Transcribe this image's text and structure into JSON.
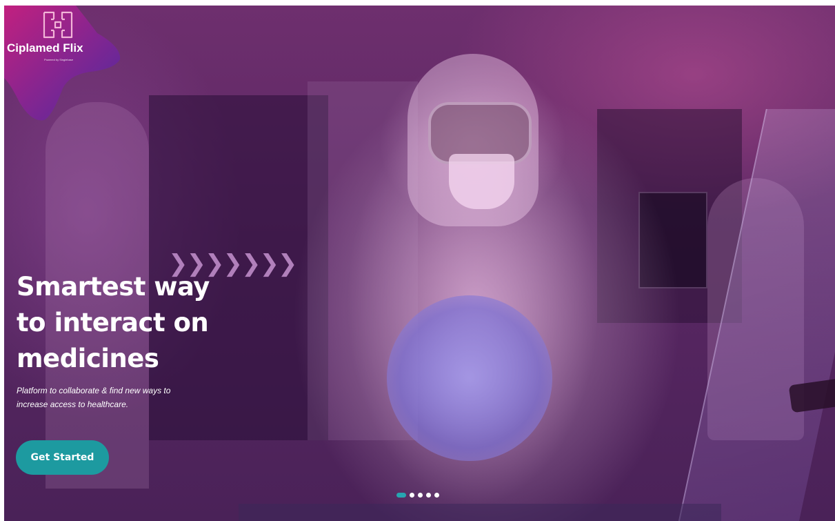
{
  "brand": {
    "name": "Ciplamed Flix",
    "tagline": "Powered by Singlebase",
    "logo_icon": "medical-cross-logo-icon",
    "gradient_colors": [
      "#c2207f",
      "#4b2aa0"
    ]
  },
  "hero": {
    "title_lines": [
      "Smartest way",
      "to interact on",
      "medicines"
    ],
    "subtitle_lines": [
      "Platform to collaborate & find new ways to",
      "increase access to healthcare."
    ],
    "cta_label": "Get Started",
    "cta_color": "#1d9aa0",
    "overlay_color": "#6e2f6e"
  },
  "carousel": {
    "slide_count": 5,
    "active_index": 0,
    "active_color": "#27a6b1"
  }
}
